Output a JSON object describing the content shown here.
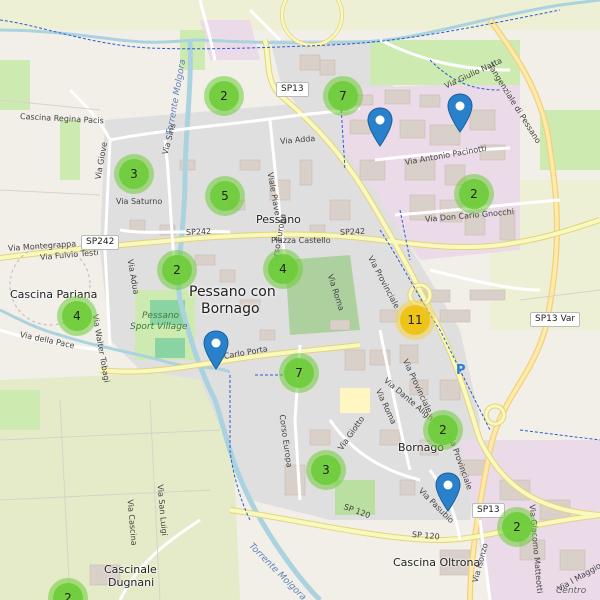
{
  "map": {
    "clusters": [
      {
        "id": "c1",
        "count": "2"
      },
      {
        "id": "c2",
        "count": "7"
      },
      {
        "id": "c3",
        "count": "3"
      },
      {
        "id": "c4",
        "count": "5"
      },
      {
        "id": "c5",
        "count": "2"
      },
      {
        "id": "c6",
        "count": "2"
      },
      {
        "id": "c7",
        "count": "4"
      },
      {
        "id": "c8",
        "count": "4"
      },
      {
        "id": "c9",
        "count": "11"
      },
      {
        "id": "c10",
        "count": "7"
      },
      {
        "id": "c11",
        "count": "2"
      },
      {
        "id": "c12",
        "count": "3"
      },
      {
        "id": "c13",
        "count": "2"
      },
      {
        "id": "c14",
        "count": "2"
      }
    ],
    "labels": {
      "pessano_con_bornago": "Pessano con",
      "bornago_line": "Bornago",
      "pessano": "Pessano",
      "bornago": "Bornago",
      "cascina_pariana": "Cascina Pariana",
      "cascine_dugnani_1": "Cascinale",
      "cascine_dugnani_2": "Dugnani",
      "cascina_oltrona": "Cascina Oltrona",
      "cascina_regina_pacis": "Cascina Regina Pacis",
      "pessano_sport_village_1": "Pessano",
      "pessano_sport_village_2": "Sport Village",
      "torrente_molgora_top": "Torrente Molgora",
      "torrente_molgora_bottom": "Torrente Molgora",
      "tangenziale": "Tangenziale di Pessano",
      "centro": "Centro",
      "via_giulio_natta": "Via Giulio Natta",
      "via_antonio_pacinotti": "Via Antonio Pacinotti",
      "via_don_carlo_gnocchi": "Via Don Carlo Gnocchi",
      "via_adda": "Via Adda",
      "via_piave": "Viale Piave",
      "via_siris": "Via Siris",
      "via_giove": "Via Giove",
      "via_saturno": "Via Saturno",
      "via_montegrappa": "Via Montegrappa",
      "via_fulvio_testi": "Via Fulvio Testi",
      "via_adua": "Via Adua",
      "via_walter_tobagi": "Via Walter Tobagi",
      "via_della_pace": "Via della Pace",
      "piazza_castello": "Piazza Castello",
      "corso_europa_top": "Corso Europa",
      "corso_europa": "Corso Europa",
      "via_carlo_porta": "Carlo Porta",
      "via_roma": "Via Roma",
      "via_roma2": "Via Roma",
      "via_provinciale": "Via Provinciale",
      "via_provinciale2": "Via Provinciale",
      "via_provinciale3": "Via Provinciale",
      "via_dante_alighieri": "Via Dante Alighieri",
      "via_giotto": "Via Giotto",
      "via_pasubio": "Via Pasubio",
      "via_isonzo": "Via Isonzo",
      "via_giacomo_matteotti": "Via Giacomo Matteotti",
      "via_i_maggio": "Via I Maggio",
      "via_san_luigi": "Via San Luigi",
      "via_cascina": "Via Cascina",
      "sp242_a": "SP242",
      "sp242_b": "SP242",
      "sp120": "SP 120",
      "sp120_b": "SP 120"
    },
    "shields": {
      "sp13_top": "SP13",
      "sp242": "SP242",
      "sp13_var": "SP13 Var",
      "sp13_bottom": "SP13"
    },
    "parking": "P",
    "colors": {
      "cluster_green": "#6ecc39",
      "cluster_yellow": "#f0c20c",
      "pin": "#2a81cb",
      "water": "#aad3df",
      "road_yellow": "#f7fabf",
      "residential": "#e0dfdf",
      "industrial": "#ebdbe8",
      "grass": "#cdebb0",
      "farmland": "#eef0d5"
    },
    "icons": {
      "pin": "map-marker-icon",
      "parking": "parking-icon"
    }
  }
}
